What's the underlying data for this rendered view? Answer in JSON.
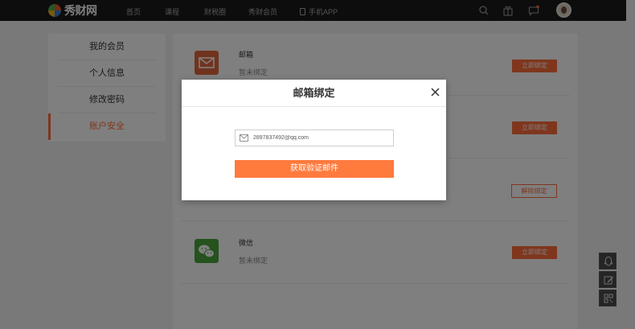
{
  "topbar": {
    "logo_text": "秀财网",
    "nav": [
      {
        "label": "首页"
      },
      {
        "label": "课程"
      },
      {
        "label": "财税圈"
      },
      {
        "label": "秀财会员"
      },
      {
        "label": "手机APP"
      }
    ]
  },
  "sidebar": {
    "items": [
      {
        "label": "我的会员",
        "active": false
      },
      {
        "label": "个人信息",
        "active": false
      },
      {
        "label": "修改密码",
        "active": false
      },
      {
        "label": "账户安全",
        "active": true
      }
    ]
  },
  "bindings": {
    "rows": [
      {
        "title": "邮箱",
        "status": "暂未绑定",
        "action": "立即绑定",
        "icon": "mail-icon"
      },
      {
        "title": "",
        "status": "",
        "action": "立即绑定",
        "icon": ""
      },
      {
        "title": "",
        "status": "",
        "action": "解除绑定",
        "icon": ""
      },
      {
        "title": "微信",
        "status": "暂未绑定",
        "action": "立即绑定",
        "icon": "wechat-icon"
      }
    ]
  },
  "dialog": {
    "title": "邮箱绑定",
    "email_value": "2897837492@qq.com",
    "submit_label": "获取验证邮件"
  },
  "colors": {
    "accent": "#ff6d3b",
    "topbar": "#1b1b1b",
    "mail_icon_bg": "#e2673b",
    "wechat_icon_bg": "#4aa53a"
  }
}
